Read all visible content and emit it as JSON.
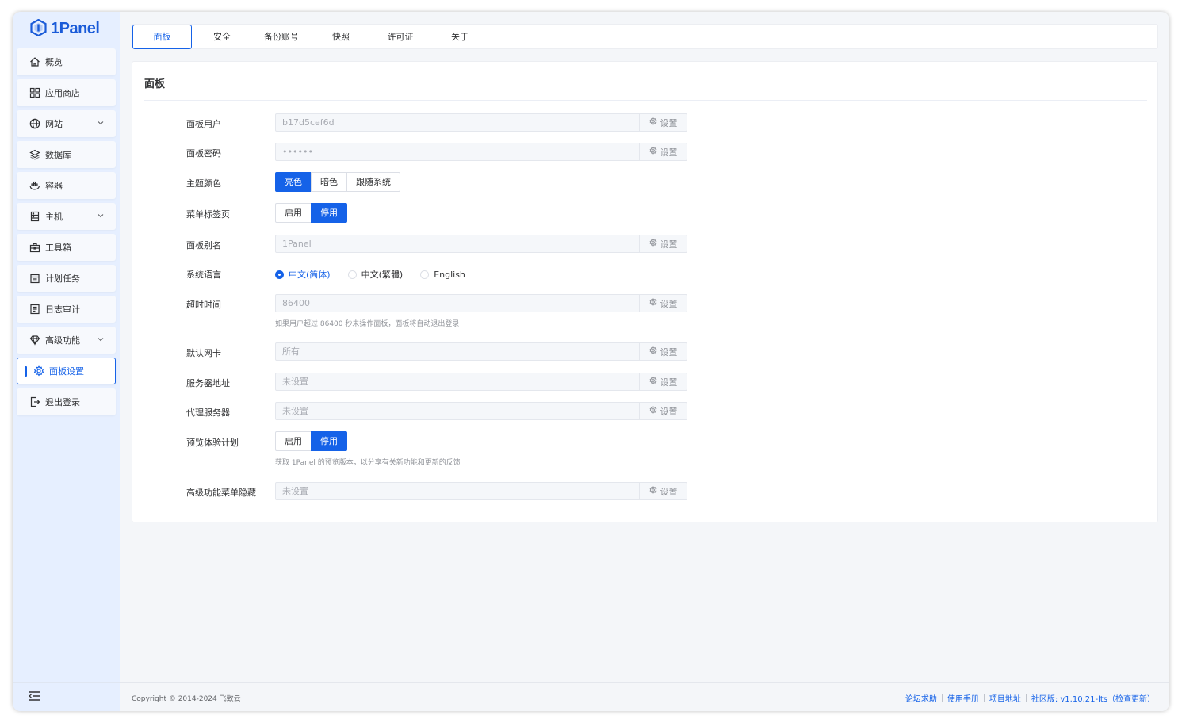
{
  "app": {
    "logo_text": "1Panel"
  },
  "sidebar": {
    "items": [
      {
        "label": "概览",
        "icon": "home-icon"
      },
      {
        "label": "应用商店",
        "icon": "grid-icon"
      },
      {
        "label": "网站",
        "icon": "globe-icon"
      },
      {
        "label": "数据库",
        "icon": "layers-icon"
      },
      {
        "label": "容器",
        "icon": "docker-icon"
      },
      {
        "label": "主机",
        "icon": "server-icon"
      },
      {
        "label": "工具箱",
        "icon": "toolbox-icon"
      },
      {
        "label": "计划任务",
        "icon": "calendar-icon"
      },
      {
        "label": "日志审计",
        "icon": "log-icon"
      },
      {
        "label": "高级功能",
        "icon": "diamond-icon"
      },
      {
        "label": "面板设置",
        "icon": "gear-icon"
      },
      {
        "label": "退出登录",
        "icon": "logout-icon"
      }
    ]
  },
  "tabs": [
    "面板",
    "安全",
    "备份账号",
    "快照",
    "许可证",
    "关于"
  ],
  "card": {
    "title": "面板",
    "set_label": "设置",
    "panel_user": {
      "label": "面板用户",
      "value": "b17d5cef6d"
    },
    "panel_password": {
      "label": "面板密码",
      "value": "••••••"
    },
    "theme": {
      "label": "主题颜色",
      "options": [
        "亮色",
        "暗色",
        "跟随系统"
      ],
      "selected": "亮色"
    },
    "menu_tabs": {
      "label": "菜单标签页",
      "options": [
        "启用",
        "停用"
      ],
      "selected": "停用"
    },
    "panel_alias": {
      "label": "面板别名",
      "value": "1Panel"
    },
    "language": {
      "label": "系统语言",
      "options": [
        "中文(简体)",
        "中文(繁體)",
        "English"
      ],
      "selected": "中文(简体)"
    },
    "timeout": {
      "label": "超时时间",
      "value": "86400",
      "hint": "如果用户超过 86400 秒未操作面板，面板将自动退出登录"
    },
    "default_nic": {
      "label": "默认网卡",
      "value": "所有"
    },
    "server_address": {
      "label": "服务器地址",
      "value": "未设置"
    },
    "proxy_server": {
      "label": "代理服务器",
      "value": "未设置"
    },
    "preview_plan": {
      "label": "预览体验计划",
      "options": [
        "启用",
        "停用"
      ],
      "selected": "停用",
      "hint": "获取 1Panel 的预览版本，以分享有关新功能和更新的反馈"
    },
    "advanced_menu_hide": {
      "label": "高级功能菜单隐藏",
      "value": "未设置"
    }
  },
  "footer": {
    "copyright": "Copyright © 2014-2024 飞致云",
    "links": [
      "论坛求助",
      "使用手册",
      "项目地址"
    ],
    "version": "社区版: v1.10.21-lts（检查更新）"
  },
  "colors": {
    "primary": "#1562e8",
    "sidebar_bg": "#e6efff",
    "page_bg": "#f4f6f9"
  }
}
